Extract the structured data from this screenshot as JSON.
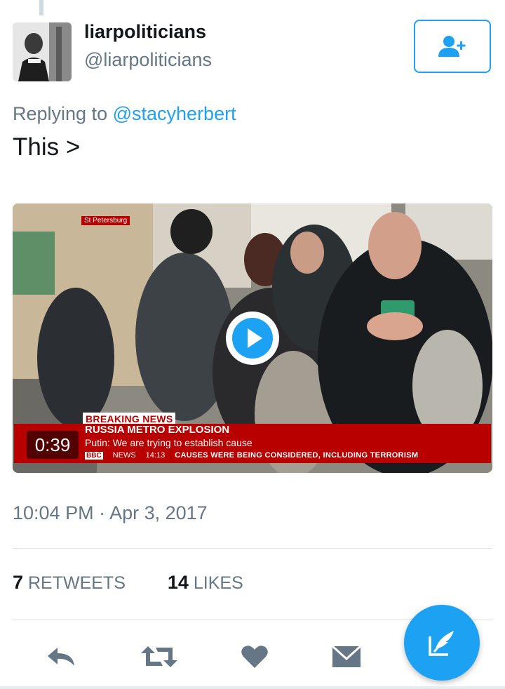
{
  "tweet": {
    "display_name": "liarpoliticians",
    "handle": "@liarpoliticians",
    "replying_prefix": "Replying to",
    "replying_mention": "@stacyherbert",
    "text": "This >",
    "timestamp": "10:04 PM · Apr 3, 2017"
  },
  "video": {
    "duration": "0:39",
    "location_tag": "St Petersburg",
    "breaking": "BREAKING NEWS",
    "headline": "RUSSIA METRO EXPLOSION",
    "subheadline": "Putin: We are trying to establish cause",
    "bbc_logo": "BBC",
    "news_label": "NEWS",
    "clock": "14:13",
    "crawl": "CAUSES WERE BEING CONSIDERED, INCLUDING TERRORISM"
  },
  "stats": {
    "retweets_count": "7",
    "retweets_label": "RETWEETS",
    "likes_count": "14",
    "likes_label": "LIKES"
  },
  "icons": {
    "follow": "add-user-icon",
    "play": "play-icon",
    "reply": "reply-icon",
    "retweet": "retweet-icon",
    "like": "heart-icon",
    "dm": "envelope-icon",
    "compose": "compose-icon"
  },
  "colors": {
    "accent": "#1da1f2",
    "muted": "#657786",
    "icon_gray": "#657786",
    "bbc_red": "#b80000"
  }
}
